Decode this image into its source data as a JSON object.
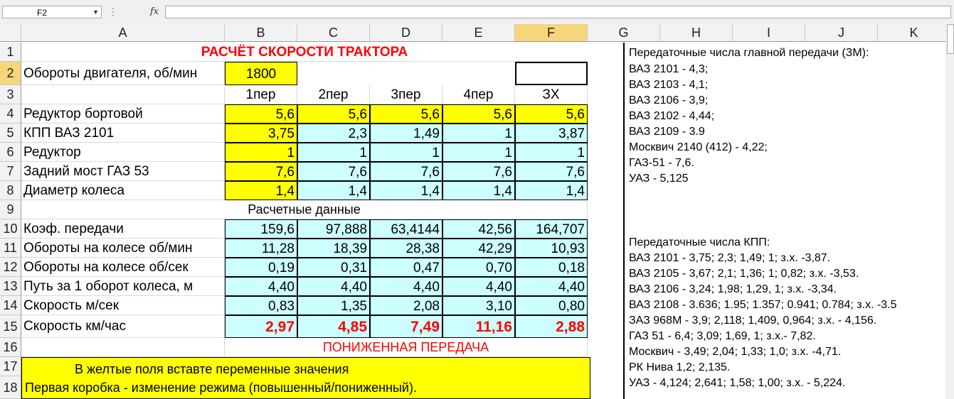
{
  "formula_bar": {
    "name_box": "F2",
    "fx": "fx",
    "formula": ""
  },
  "columns": [
    "A",
    "B",
    "C",
    "D",
    "E",
    "F",
    "G",
    "H",
    "I",
    "J",
    "K"
  ],
  "rows": [
    "1",
    "2",
    "3",
    "4",
    "5",
    "6",
    "7",
    "8",
    "9",
    "10",
    "11",
    "12",
    "13",
    "14",
    "15",
    "16",
    "17",
    "18"
  ],
  "sheet": {
    "title": "РАСЧЁТ СКОРОСТИ ТРАКТОРА",
    "engine_label": "Обороты двигателя, об/мин",
    "engine_value": "1800",
    "gears": [
      "1пер",
      "2пер",
      "3пер",
      "4пер",
      "ЗХ"
    ],
    "input_rows": [
      {
        "label": "Редуктор бортовой",
        "values": [
          "5,6",
          "5,6",
          "5,6",
          "5,6",
          "5,6"
        ]
      },
      {
        "label": "КПП ВАЗ 2101",
        "values": [
          "3,75",
          "2,3",
          "1,49",
          "1",
          "3,87"
        ]
      },
      {
        "label": "Редуктор",
        "values": [
          "1",
          "1",
          "1",
          "1",
          "1"
        ]
      },
      {
        "label": "Задний мост ГАЗ 53",
        "values": [
          "7,6",
          "7,6",
          "7,6",
          "7,6",
          "7,6"
        ]
      },
      {
        "label": "Диаметр колеса",
        "values": [
          "1,4",
          "1,4",
          "1,4",
          "1,4",
          "1,4"
        ]
      }
    ],
    "calc_header": "Расчетные данные",
    "calc_rows": [
      {
        "label": "Коэф. передачи",
        "values": [
          "159,6",
          "97,888",
          "63,4144",
          "42,56",
          "164,707"
        ]
      },
      {
        "label": "Обороты  на колесе об/мин",
        "values": [
          "11,28",
          "18,39",
          "28,38",
          "42,29",
          "10,93"
        ]
      },
      {
        "label": "Обороты  на колесе об/сек",
        "values": [
          "0,19",
          "0,31",
          "0,47",
          "0,70",
          "0,18"
        ]
      },
      {
        "label": "Путь за 1 оборот колеса, м",
        "values": [
          "4,40",
          "4,40",
          "4,40",
          "4,40",
          "4,40"
        ]
      },
      {
        "label": "Скорость м/сек",
        "values": [
          "0,83",
          "1,35",
          "2,08",
          "3,10",
          "0,80"
        ]
      }
    ],
    "speed_row": {
      "label": "Скорость км/час",
      "values": [
        "2,97",
        "4,85",
        "7,49",
        "11,16",
        "2,88"
      ]
    },
    "low_gear_label": "ПОНИЖЕННАЯ ПЕРЕДАЧА",
    "hint_line1": "В желтые поля  вставте переменные  значения",
    "hint_line2": "Первая коробка - изменение  режима  (повышенный/пониженный)."
  },
  "notes": {
    "main_gear_title": "Передаточные  числа  главной  передачи  (ЗМ):",
    "main_gear": [
      "ВАЗ 2101 - 4,3;",
      "ВАЗ 2103 - 4,1;",
      "ВАЗ 2106 - 3,9;",
      "ВАЗ 2102 - 4,44;",
      "ВАЗ 2109 - 3.9",
      "Москвич 2140 (412) - 4,22;",
      "ГАЗ-51 - 7,6.",
      "УАЗ - 5,125"
    ],
    "kpp_title": "Передаточные числа КПП:",
    "kpp": [
      "ВАЗ 2101 - 3,75; 2,3; 1,49; 1; з.х. -3,87.",
      "ВАЗ 2105 - 3,67; 2,1; 1,36; 1; 0,82; з.х. -3,53.",
      "ВАЗ 2106 - 3,24; 1,98; 1,29, 1; з.х. -3,34.",
      "ВАЗ 2108 - 3.636; 1.95; 1.357; 0.941; 0.784; з.х. -3.5",
      "ЗАЗ 968М - 3,9; 2,118; 1,409, 0,964; з.х. - 4,156.",
      "ГАЗ 51 - 6,4; 3,09; 1,69, 1; з.х.- 7,82.",
      "Москвич - 3,49; 2,04; 1,33; 1,0; з.х. -4,71.",
      "РК Нива  1,2; 2,135.",
      "УАЗ - 4,124; 2,641; 1,58; 1,00; з.х. - 5,224."
    ]
  }
}
